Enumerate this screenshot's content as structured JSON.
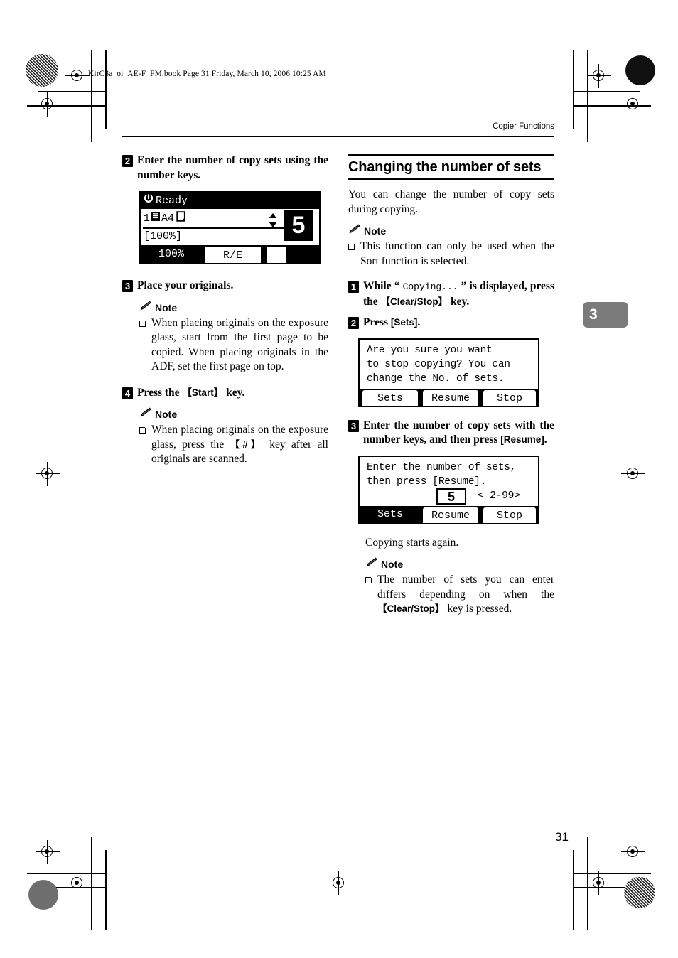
{
  "page": {
    "slug": "KirC3a_oi_AE-F_FM.book  Page 31  Friday, March 10, 2006  10:25 AM",
    "running_head": "Copier Functions",
    "folio": "31",
    "chapter_tab": "3"
  },
  "left_column": {
    "step2": {
      "number": "2",
      "text": "Enter the number of copy sets using the number keys."
    },
    "lcd_status": {
      "status_text": "Ready",
      "tray_line": "1",
      "paper_size": "A4",
      "zoom_value": "[100%]",
      "copy_count": "5",
      "tab_selected": "100%",
      "tab_other": "R/E",
      "icons": {
        "power": "power-icon",
        "tray": "paper-tray-icon",
        "sheet": "sheet-orientation-icon",
        "updown": "up-down-arrows-icon"
      }
    },
    "step3": {
      "number": "3",
      "text": "Place your originals.",
      "note_label": "Note",
      "note_items": [
        "When placing originals on the exposure glass, start from the first page to be copied. When placing originals in the ADF, set the first page on top."
      ]
    },
    "step4": {
      "number": "4",
      "text_before": "Press the ",
      "key": "【Start】",
      "text_after": " key.",
      "note_label": "Note",
      "note_before": "When placing originals on the exposure glass, press the ",
      "note_key": "【#】",
      "note_after": " key after all originals are scanned."
    }
  },
  "right_column": {
    "section_title": "Changing the number of sets",
    "intro": "You can change the number of copy sets during copying.",
    "note_label_1": "Note",
    "note_1": "This function can only be used when the Sort function is selected.",
    "step1": {
      "number": "1",
      "before": "While “ ",
      "mono": "Copying...",
      "middle": " ” is displayed, press the ",
      "key": "【Clear/Stop】",
      "after": " key."
    },
    "step2": {
      "number": "2",
      "before": "Press ",
      "key": "[Sets]",
      "after": "."
    },
    "dialog1": {
      "message": "Are you sure you want\nto stop copying? You can\nchange the No. of sets.",
      "buttons": [
        "Sets",
        "Resume",
        "Stop"
      ],
      "highlighted": ""
    },
    "step3": {
      "number": "3",
      "before": "Enter the number of copy sets with the number keys, and then press ",
      "key": "[Resume]",
      "after": "."
    },
    "dialog2": {
      "message": "Enter the number of sets,\nthen press [Resume].",
      "value": "5",
      "range": "< 2-99>",
      "buttons": [
        "Sets",
        "Resume",
        "Stop"
      ],
      "highlighted": "Sets"
    },
    "closing": "Copying starts again.",
    "note_label_2": "Note",
    "note_2_before": "The number of sets you can enter differs depending on when the ",
    "note_2_key": "【Clear/Stop】",
    "note_2_after": " key is pressed."
  }
}
